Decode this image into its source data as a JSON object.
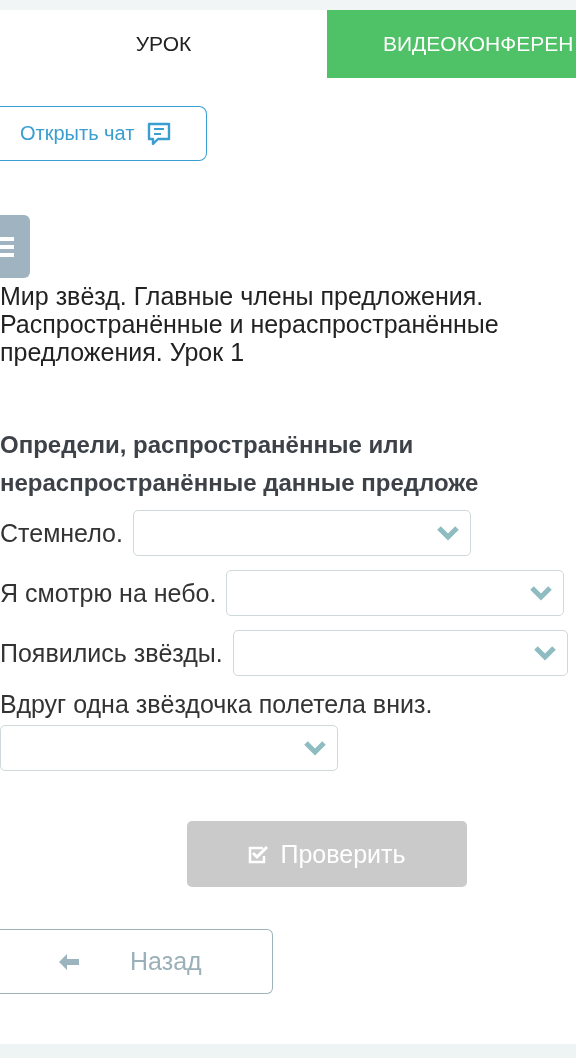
{
  "tabs": [
    {
      "label": "УРОК",
      "selected": true
    },
    {
      "label": "ВИДЕОКОНФЕРЕН",
      "selected": false
    }
  ],
  "chat_button": {
    "label": "Открыть чат"
  },
  "lesson_title": "Мир звёзд. Главные члены предложения. Распространённые и нераспространённые предложения. Урок 1",
  "question": "Определи, распространённые или нераспространённые данные предложе",
  "items": [
    {
      "sentence": "Стемнело."
    },
    {
      "sentence": "Я смотрю на небо."
    },
    {
      "sentence": "Появились звёзды."
    },
    {
      "sentence": "Вдруг одна звёздочка полетела вниз."
    }
  ],
  "check_button": {
    "label": "Проверить",
    "disabled": true
  },
  "back_button": {
    "label": "Назад"
  }
}
